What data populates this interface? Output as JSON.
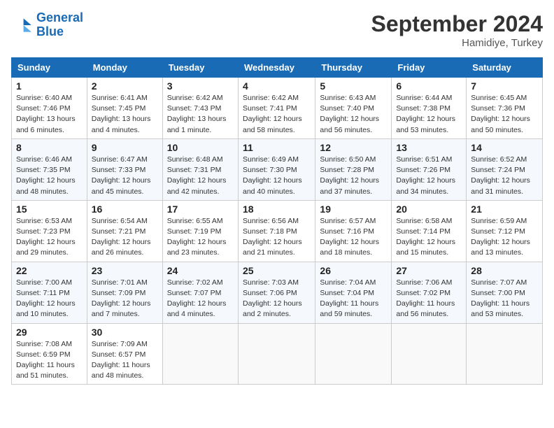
{
  "header": {
    "logo_line1": "General",
    "logo_line2": "Blue",
    "month_title": "September 2024",
    "location": "Hamidiye, Turkey"
  },
  "weekdays": [
    "Sunday",
    "Monday",
    "Tuesday",
    "Wednesday",
    "Thursday",
    "Friday",
    "Saturday"
  ],
  "weeks": [
    [
      {
        "day": "1",
        "sunrise": "6:40 AM",
        "sunset": "7:46 PM",
        "daylight": "13 hours and 6 minutes."
      },
      {
        "day": "2",
        "sunrise": "6:41 AM",
        "sunset": "7:45 PM",
        "daylight": "13 hours and 4 minutes."
      },
      {
        "day": "3",
        "sunrise": "6:42 AM",
        "sunset": "7:43 PM",
        "daylight": "13 hours and 1 minute."
      },
      {
        "day": "4",
        "sunrise": "6:42 AM",
        "sunset": "7:41 PM",
        "daylight": "12 hours and 58 minutes."
      },
      {
        "day": "5",
        "sunrise": "6:43 AM",
        "sunset": "7:40 PM",
        "daylight": "12 hours and 56 minutes."
      },
      {
        "day": "6",
        "sunrise": "6:44 AM",
        "sunset": "7:38 PM",
        "daylight": "12 hours and 53 minutes."
      },
      {
        "day": "7",
        "sunrise": "6:45 AM",
        "sunset": "7:36 PM",
        "daylight": "12 hours and 50 minutes."
      }
    ],
    [
      {
        "day": "8",
        "sunrise": "6:46 AM",
        "sunset": "7:35 PM",
        "daylight": "12 hours and 48 minutes."
      },
      {
        "day": "9",
        "sunrise": "6:47 AM",
        "sunset": "7:33 PM",
        "daylight": "12 hours and 45 minutes."
      },
      {
        "day": "10",
        "sunrise": "6:48 AM",
        "sunset": "7:31 PM",
        "daylight": "12 hours and 42 minutes."
      },
      {
        "day": "11",
        "sunrise": "6:49 AM",
        "sunset": "7:30 PM",
        "daylight": "12 hours and 40 minutes."
      },
      {
        "day": "12",
        "sunrise": "6:50 AM",
        "sunset": "7:28 PM",
        "daylight": "12 hours and 37 minutes."
      },
      {
        "day": "13",
        "sunrise": "6:51 AM",
        "sunset": "7:26 PM",
        "daylight": "12 hours and 34 minutes."
      },
      {
        "day": "14",
        "sunrise": "6:52 AM",
        "sunset": "7:24 PM",
        "daylight": "12 hours and 31 minutes."
      }
    ],
    [
      {
        "day": "15",
        "sunrise": "6:53 AM",
        "sunset": "7:23 PM",
        "daylight": "12 hours and 29 minutes."
      },
      {
        "day": "16",
        "sunrise": "6:54 AM",
        "sunset": "7:21 PM",
        "daylight": "12 hours and 26 minutes."
      },
      {
        "day": "17",
        "sunrise": "6:55 AM",
        "sunset": "7:19 PM",
        "daylight": "12 hours and 23 minutes."
      },
      {
        "day": "18",
        "sunrise": "6:56 AM",
        "sunset": "7:18 PM",
        "daylight": "12 hours and 21 minutes."
      },
      {
        "day": "19",
        "sunrise": "6:57 AM",
        "sunset": "7:16 PM",
        "daylight": "12 hours and 18 minutes."
      },
      {
        "day": "20",
        "sunrise": "6:58 AM",
        "sunset": "7:14 PM",
        "daylight": "12 hours and 15 minutes."
      },
      {
        "day": "21",
        "sunrise": "6:59 AM",
        "sunset": "7:12 PM",
        "daylight": "12 hours and 13 minutes."
      }
    ],
    [
      {
        "day": "22",
        "sunrise": "7:00 AM",
        "sunset": "7:11 PM",
        "daylight": "12 hours and 10 minutes."
      },
      {
        "day": "23",
        "sunrise": "7:01 AM",
        "sunset": "7:09 PM",
        "daylight": "12 hours and 7 minutes."
      },
      {
        "day": "24",
        "sunrise": "7:02 AM",
        "sunset": "7:07 PM",
        "daylight": "12 hours and 4 minutes."
      },
      {
        "day": "25",
        "sunrise": "7:03 AM",
        "sunset": "7:06 PM",
        "daylight": "12 hours and 2 minutes."
      },
      {
        "day": "26",
        "sunrise": "7:04 AM",
        "sunset": "7:04 PM",
        "daylight": "11 hours and 59 minutes."
      },
      {
        "day": "27",
        "sunrise": "7:06 AM",
        "sunset": "7:02 PM",
        "daylight": "11 hours and 56 minutes."
      },
      {
        "day": "28",
        "sunrise": "7:07 AM",
        "sunset": "7:00 PM",
        "daylight": "11 hours and 53 minutes."
      }
    ],
    [
      {
        "day": "29",
        "sunrise": "7:08 AM",
        "sunset": "6:59 PM",
        "daylight": "11 hours and 51 minutes."
      },
      {
        "day": "30",
        "sunrise": "7:09 AM",
        "sunset": "6:57 PM",
        "daylight": "11 hours and 48 minutes."
      },
      null,
      null,
      null,
      null,
      null
    ]
  ]
}
